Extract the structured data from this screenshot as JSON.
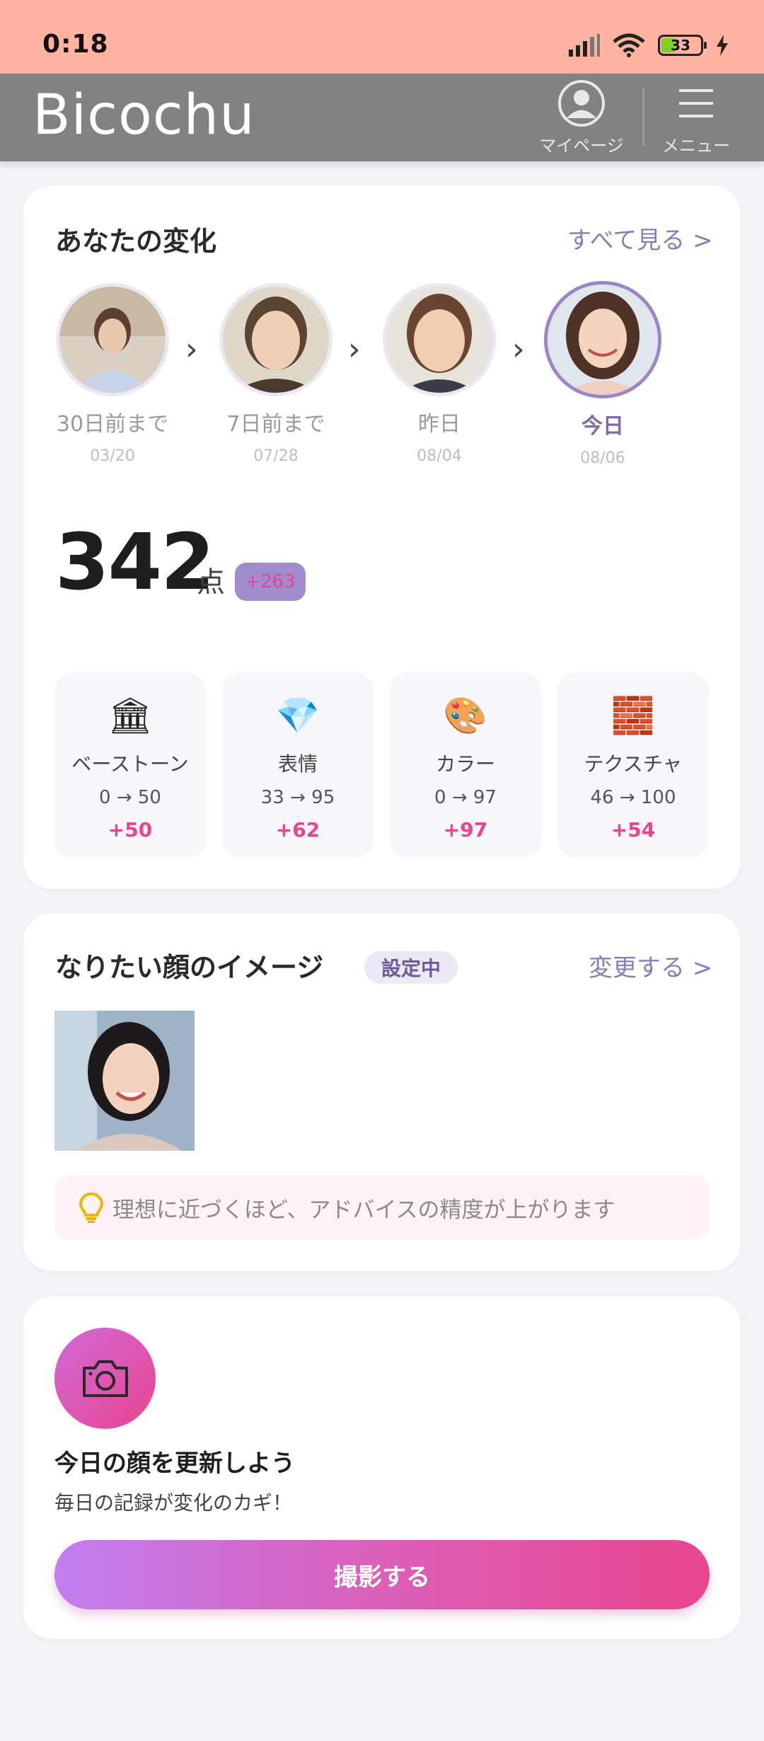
{
  "status": {
    "time": "0:18",
    "battery": "33"
  },
  "appbar": {
    "title": "Bicochu",
    "mypage_label": "マイページ",
    "menu_label": "メニュー"
  },
  "change_card": {
    "title": "あなたの変化",
    "see_all": "すべて見る >",
    "timeline": [
      {
        "label": "30日前まで",
        "date": "03/20"
      },
      {
        "label": "7日前まで",
        "date": "07/28"
      },
      {
        "label": "昨日",
        "date": "08/04"
      },
      {
        "label": "今日",
        "date": "08/06"
      }
    ],
    "score": "342",
    "score_unit": "点",
    "score_delta": "+263",
    "metrics": [
      {
        "icon": "🏛",
        "icon_name": "bank-icon",
        "name": "ベーストーン",
        "range": "0 → 50",
        "delta": "+50"
      },
      {
        "icon": "💎",
        "icon_name": "gem-icon",
        "name": "表情",
        "range": "33 → 95",
        "delta": "+62"
      },
      {
        "icon": "🎨",
        "icon_name": "palette-icon",
        "name": "カラー",
        "range": "0 → 97",
        "delta": "+97"
      },
      {
        "icon": "🧱",
        "icon_name": "brick-icon",
        "name": "テクスチャ",
        "range": "46 → 100",
        "delta": "+54"
      }
    ]
  },
  "ideal_card": {
    "title": "なりたい顔のイメージ",
    "badge": "設定中",
    "change_link": "変更する >",
    "tip": "理想に近づくほど、アドバイスの精度が上がります"
  },
  "update_card": {
    "title": "今日の顔を更新しよう",
    "subtitle": "毎日の記録が変化のカギ！",
    "button": "撮影する"
  },
  "colors": {
    "accent_purple": "#8b7bb8",
    "accent_pink": "#e8458e",
    "statusbar": "#ffb3a0",
    "appbar": "#828282"
  }
}
